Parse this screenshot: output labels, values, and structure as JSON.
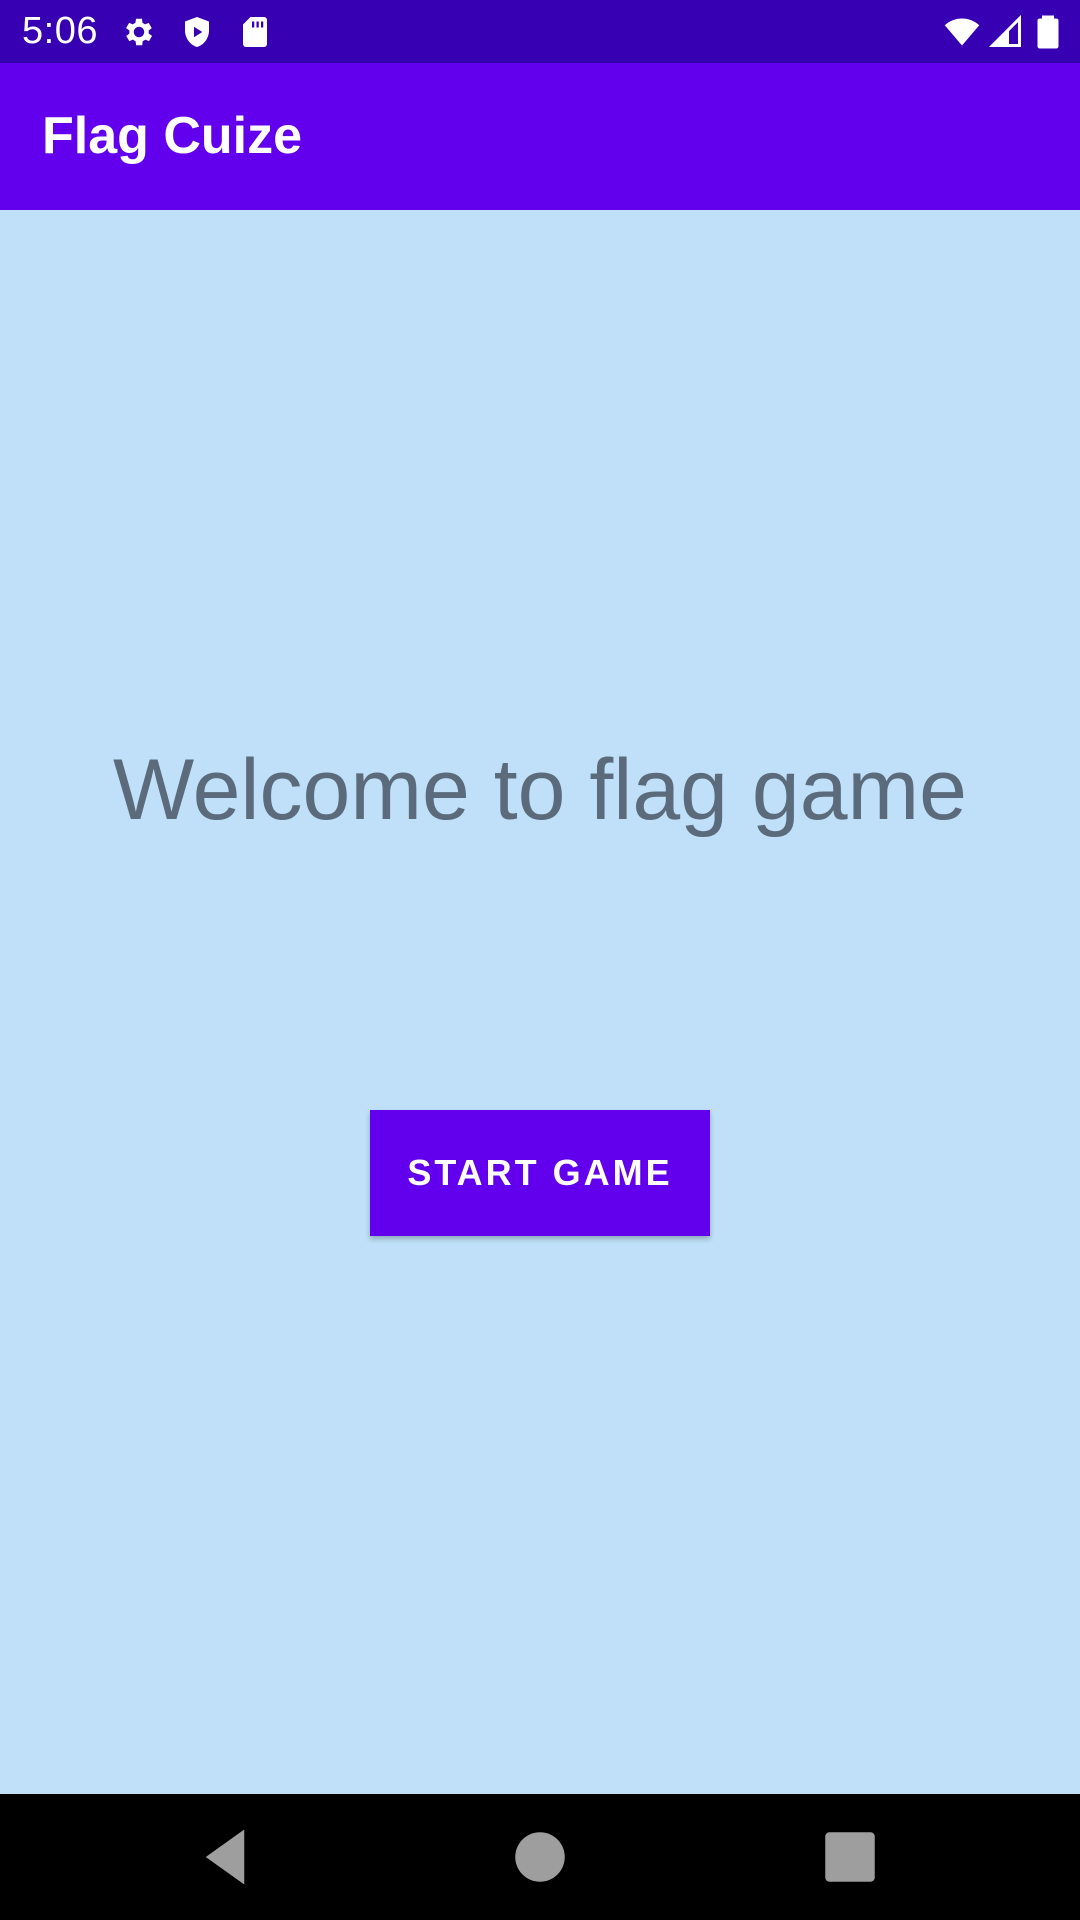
{
  "status_bar": {
    "time": "5:06",
    "left_icons": [
      "gear-icon",
      "shield-icon",
      "sd-card-icon"
    ],
    "right_icons": [
      "wifi-icon",
      "cellular-signal-icon",
      "battery-icon"
    ],
    "background_color": "#3700B3"
  },
  "app_bar": {
    "title": "Flag Cuize",
    "background_color": "#6200EE"
  },
  "main": {
    "welcome_text": "Welcome to flag game",
    "start_button_label": "START GAME",
    "background_color": "#BFE0F8"
  },
  "nav_bar": {
    "buttons": [
      "back-icon",
      "home-icon",
      "recents-icon"
    ]
  }
}
